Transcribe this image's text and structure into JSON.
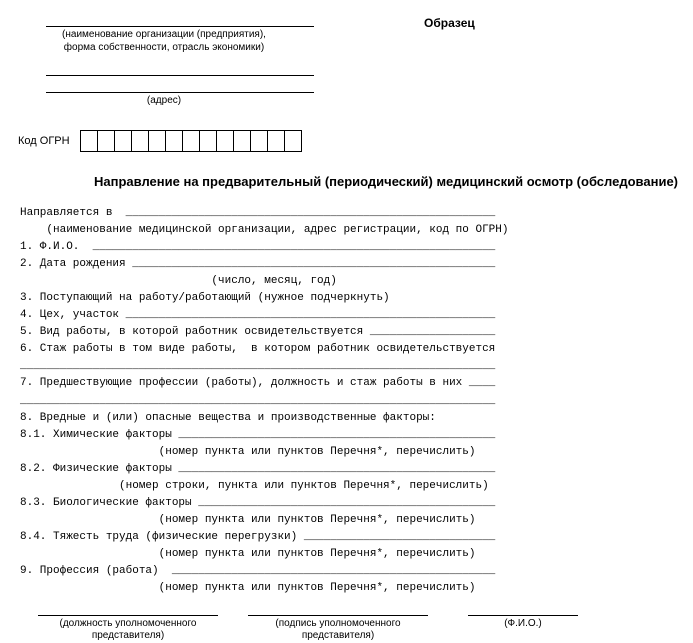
{
  "header": {
    "sample": "Образец",
    "org_caption_line1": "(наименование организации (предприятия),",
    "org_caption_line2": "форма собственности, отрасль экономики)",
    "address_caption": "(адрес)",
    "ogrn_label": "Код ОГРН",
    "title": "Направление на предварительный (периодический) медицинский осмотр (обследование)"
  },
  "body": {
    "l01": "Направляется в  ________________________________________________________",
    "l02": "    (наименование медицинской организации, адрес регистрации, код по ОГРН)",
    "l03": "1. Ф.И.О.  _____________________________________________________________",
    "l04": "2. Дата рождения _______________________________________________________",
    "l05": "                             (число, месяц, год)",
    "l06": "3. Поступающий на работу/работающий (нужное подчеркнуть)",
    "l07": "4. Цех, участок ________________________________________________________",
    "l08": "5. Вид работы, в которой работник освидетельствуется ___________________",
    "l09": "6. Стаж работы в том виде работы,  в котором работник освидетельствуется",
    "l10": "________________________________________________________________________",
    "l11": "7. Предшествующие профессии (работы), должность и стаж работы в них ____",
    "l12": "________________________________________________________________________",
    "l13": "8. Вредные и (или) опасные вещества и производственные факторы:",
    "l14": "8.1. Химические факторы ________________________________________________",
    "l15": "                     (номер пункта или пунктов Перечня*, перечислить)",
    "l16": "8.2. Физические факторы ________________________________________________",
    "l17": "               (номер строки, пункта или пунктов Перечня*, перечислить)",
    "l18": "8.3. Биологические факторы _____________________________________________",
    "l19": "                     (номер пункта или пунктов Перечня*, перечислить)",
    "l20": "8.4. Тяжесть труда (физические перегрузки) _____________________________",
    "l21": "                     (номер пункта или пунктов Перечня*, перечислить)",
    "l22": "9. Профессия (работа)  _________________________________________________",
    "l23": "                     (номер пункта или пунктов Перечня*, перечислить)"
  },
  "footer": {
    "col1": "(должность уполномоченного представителя)",
    "col2": "(подпись уполномоченного представителя)",
    "col3": "(Ф.И.О.)"
  }
}
